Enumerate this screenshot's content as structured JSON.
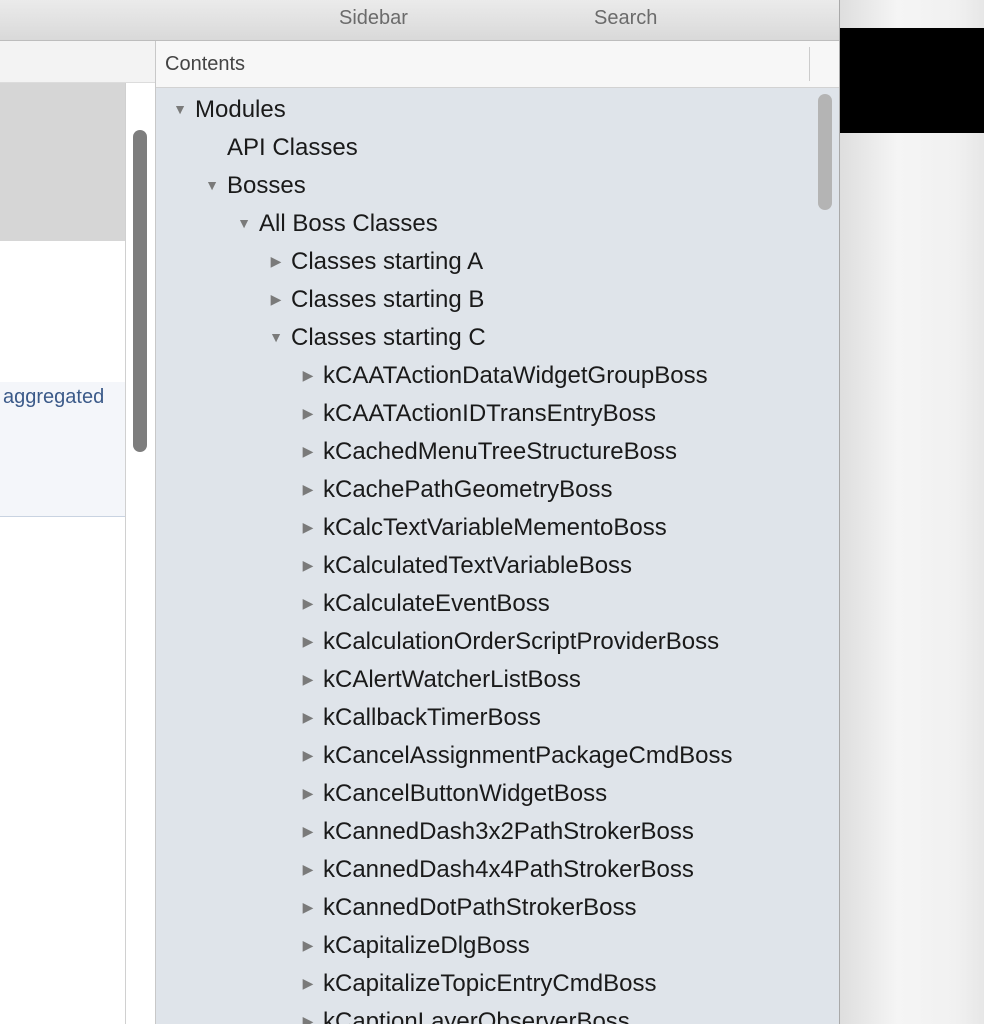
{
  "toolbar": {
    "sidebar_label": "Sidebar",
    "search_label": "Search"
  },
  "content": {
    "partial_text": "aggregated"
  },
  "sidebar": {
    "header": "Contents",
    "tree": [
      {
        "label": "Modules",
        "state": "expanded"
      },
      {
        "label": "API Classes",
        "state": "leaf"
      },
      {
        "label": "Bosses",
        "state": "expanded"
      },
      {
        "label": "All Boss Classes",
        "state": "expanded"
      },
      {
        "label": "Classes starting A",
        "state": "collapsed"
      },
      {
        "label": "Classes starting B",
        "state": "collapsed"
      },
      {
        "label": "Classes starting C",
        "state": "expanded"
      },
      {
        "label": "kCAATActionDataWidgetGroupBoss",
        "state": "collapsed"
      },
      {
        "label": "kCAATActionIDTransEntryBoss",
        "state": "collapsed"
      },
      {
        "label": "kCachedMenuTreeStructureBoss",
        "state": "collapsed"
      },
      {
        "label": "kCachePathGeometryBoss",
        "state": "collapsed"
      },
      {
        "label": "kCalcTextVariableMementoBoss",
        "state": "collapsed"
      },
      {
        "label": "kCalculatedTextVariableBoss",
        "state": "collapsed"
      },
      {
        "label": "kCalculateEventBoss",
        "state": "collapsed"
      },
      {
        "label": "kCalculationOrderScriptProviderBoss",
        "state": "collapsed"
      },
      {
        "label": "kCAlertWatcherListBoss",
        "state": "collapsed"
      },
      {
        "label": "kCallbackTimerBoss",
        "state": "collapsed"
      },
      {
        "label": "kCancelAssignmentPackageCmdBoss",
        "state": "collapsed"
      },
      {
        "label": "kCancelButtonWidgetBoss",
        "state": "collapsed"
      },
      {
        "label": "kCannedDash3x2PathStrokerBoss",
        "state": "collapsed"
      },
      {
        "label": "kCannedDash4x4PathStrokerBoss",
        "state": "collapsed"
      },
      {
        "label": "kCannedDotPathStrokerBoss",
        "state": "collapsed"
      },
      {
        "label": "kCapitalizeDlgBoss",
        "state": "collapsed"
      },
      {
        "label": "kCapitalizeTopicEntryCmdBoss",
        "state": "collapsed"
      },
      {
        "label": "kCaptionLayerObserverBoss",
        "state": "collapsed"
      }
    ],
    "icons": {
      "expanded": "disclosure-triangle-down-icon",
      "collapsed": "disclosure-triangle-right-icon"
    }
  }
}
